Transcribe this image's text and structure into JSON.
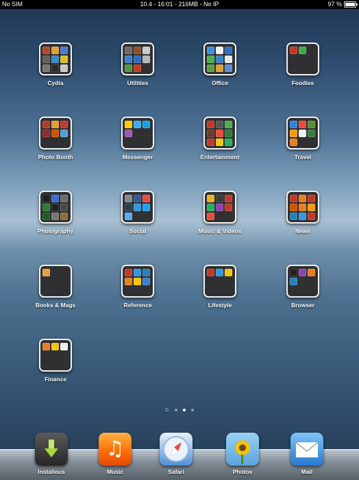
{
  "status_bar": {
    "carrier": "No SIM",
    "center": "10.4 - 16:01 - 216MB - No IP",
    "battery_text": "97 %",
    "battery_level": 0.97
  },
  "folders": [
    {
      "label": "Cydia",
      "icons": [
        "#b7462f",
        "#e0a03a",
        "#4b7ad1",
        "#5f5f5f",
        "#3a87c9",
        "#d8c22c",
        "#777777",
        "#2a2a2a",
        "#c9c9c9"
      ]
    },
    {
      "label": "Utilities",
      "icons": [
        "#6b6b6b",
        "#8e4f2a",
        "#c9c9c9",
        "#3f7fcf",
        "#2f6dbf",
        "#b8b8b8",
        "#4d9a3a",
        "#c0392b"
      ]
    },
    {
      "label": "Office",
      "icons": [
        "#3c8ee0",
        "#f0f0f0",
        "#2b6fc7",
        "#4caf50",
        "#3b82c4",
        "#e8e8e8",
        "#5aa04a",
        "#d9a23a",
        "#5b8fd0"
      ]
    },
    {
      "label": "Foodies",
      "icons": [
        "#c0392b",
        "#3ea84b"
      ]
    },
    {
      "label": "Photo Booth",
      "icons": [
        "#b33b2a",
        "#e0a03a",
        "#c0392b",
        "#8e2b2b",
        "#d35400",
        "#5b9bd5"
      ]
    },
    {
      "label": "Messenger",
      "icons": [
        "#ffcc00",
        "#3fa9f5",
        "#1fa0e0",
        "#9b59b6"
      ]
    },
    {
      "label": "Entertainment",
      "icons": [
        "#c0392b",
        "#555555",
        "#4caf50",
        "#6a3d2a",
        "#e74c3c",
        "#2e7d32",
        "#c0392b",
        "#f1c40f",
        "#27ae60"
      ]
    },
    {
      "label": "Travel",
      "icons": [
        "#2e86de",
        "#e74c3c",
        "#5a8f3a",
        "#f39c12",
        "#ecf0f1",
        "#3a7d44",
        "#e67e22"
      ]
    },
    {
      "label": "Photography",
      "icons": [
        "#1e1e1e",
        "#3a6fd0",
        "#6c6c6c",
        "#2e7d32",
        "#222222",
        "#4a4a4a",
        "#1b5e20",
        "#777777",
        "#8e6e3a"
      ]
    },
    {
      "label": "Social",
      "icons": [
        "#7f8c8d",
        "#3b5998",
        "#e74c3c",
        "#2c3e50",
        "#3498db",
        "#1da1f2",
        "#55acee"
      ]
    },
    {
      "label": "Music & Videos",
      "icons": [
        "#e6b422",
        "#3a3a3a",
        "#c0392b",
        "#27ae60",
        "#8e44ad",
        "#c0392b",
        "#e74c3c"
      ]
    },
    {
      "label": "News",
      "icons": [
        "#c0392b",
        "#e67e22",
        "#c0392b",
        "#d35400",
        "#e67e22",
        "#f39c12",
        "#2980b9",
        "#3498db",
        "#c0392b"
      ]
    },
    {
      "label": "Books & Mags",
      "icons": [
        "#e6a23c"
      ]
    },
    {
      "label": "Reference",
      "icons": [
        "#c0392b",
        "#3498db",
        "#2980b9",
        "#e67e22",
        "#f1c40f",
        "#3d7fd1"
      ]
    },
    {
      "label": "Lifestyle",
      "icons": [
        "#c0392b",
        "#3498db",
        "#f1c40f"
      ]
    },
    {
      "label": "Browser",
      "icons": [
        "#222222",
        "#8e44ad",
        "#e67e22",
        "#2980b9"
      ]
    },
    {
      "label": "Finance",
      "icons": [
        "#e67e22",
        "#f1c40f",
        "#ecf0f1"
      ]
    }
  ],
  "page_dots": {
    "count": 3,
    "active_index": 1,
    "search_first": true
  },
  "dock": [
    {
      "label": "Installous",
      "icon": "installous-icon"
    },
    {
      "label": "Music",
      "icon": "music-icon"
    },
    {
      "label": "Safari",
      "icon": "safari-icon"
    },
    {
      "label": "Photos",
      "icon": "photos-icon"
    },
    {
      "label": "Mail",
      "icon": "mail-icon"
    }
  ]
}
